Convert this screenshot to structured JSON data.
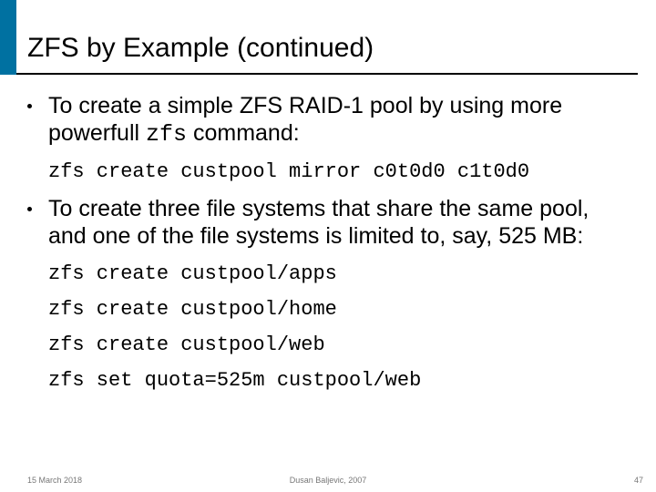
{
  "slide": {
    "title": "ZFS by Example (continued)",
    "bullets": [
      {
        "text_before": "To create a simple ZFS RAID-1 pool by using more powerfull ",
        "code_inline": "zfs",
        "text_after": " command:",
        "code_lines": [
          "zfs create custpool mirror c0t0d0 c1t0d0"
        ]
      },
      {
        "text_before": "To create three file systems that share the same pool, and one of the file systems is limited to, say, 525 MB:",
        "code_inline": "",
        "text_after": "",
        "code_lines": [
          "zfs create custpool/apps",
          "zfs create custpool/home",
          "zfs create custpool/web",
          "zfs set quota=525m custpool/web"
        ]
      }
    ]
  },
  "footer": {
    "date": "15 March 2018",
    "author": "Dusan Baljevic, 2007",
    "page": "47"
  }
}
